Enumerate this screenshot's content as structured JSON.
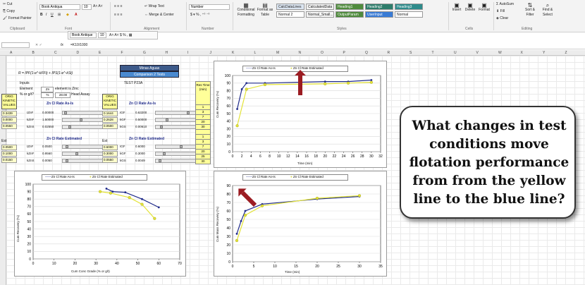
{
  "ribbon": {
    "clipboard": {
      "cut": "Cut",
      "copy": "Copy",
      "format_painter": "Format Painter",
      "group": "Clipboard"
    },
    "font": {
      "name": "Book Antiqua",
      "size": "10",
      "group": "Font"
    },
    "alignment": {
      "wrap": "Wrap Text",
      "merge": "Merge & Center",
      "group": "Alignment"
    },
    "number": {
      "format": "Number",
      "group": "Number"
    },
    "styles": {
      "conditional": "Conditional Formatting",
      "format_table": "Format as Table",
      "cells": [
        {
          "label": "Normal 2",
          "bg": "#ffffff"
        },
        {
          "label": "CalcDataLines",
          "bg": "#dbe5f1"
        },
        {
          "label": "CalculatedData",
          "bg": "#f2f2f2"
        },
        {
          "label": "Heading1",
          "bg": "#4f8b3d"
        },
        {
          "label": "Heading2",
          "bg": "#2e7d6b"
        },
        {
          "label": "Heading3",
          "bg": "#2e8b8b"
        },
        {
          "label": "Normal 2",
          "bg": "#ffffff"
        },
        {
          "label": "Normal_Small...",
          "bg": "#f7f7f7"
        },
        {
          "label": "OutputParam",
          "bg": "#4f8b3d"
        },
        {
          "label": "UserInput",
          "bg": "#3a7bd5"
        },
        {
          "label": "Normal",
          "bg": "#ffffff"
        }
      ],
      "group": "Styles"
    },
    "cells": {
      "insert": "Insert",
      "delete": "Delete",
      "format": "Format",
      "group": "Cells"
    },
    "editing": {
      "autosum": "AutoSum",
      "fill": "Fill",
      "clear": "Clear",
      "sort": "Sort & Filter",
      "find": "Find & Select",
      "group": "Editing"
    },
    "mini_font": "Book Antique",
    "mini_size": "10"
  },
  "formula_bar": {
    "name_box": "",
    "formula": "=K10/1000"
  },
  "columns": [
    "A",
    "B",
    "C",
    "D",
    "E",
    "F",
    "G",
    "H",
    "I",
    "J",
    "K",
    "L",
    "M",
    "N",
    "O",
    "P",
    "Q",
    "R",
    "S",
    "T",
    "U",
    "V",
    "W",
    "X",
    "Y",
    "Z"
  ],
  "sheet": {
    "formula": "R = IPF(1-e^-kFFt) + IPS(1-e^-kSt)",
    "inputs": "Inputs",
    "element_label": "Element",
    "element_value": "Zn",
    "element_note": "element is Zinc",
    "units_label": "% or g/t?",
    "units_value": "%",
    "head_value": "28.00",
    "head_label": "Head Assay",
    "minas": "Minas Aguas",
    "comparison": "Comparison 2 Tests",
    "test": "TEST P23A",
    "orig_box": "ORIG KINETIC VALUES",
    "asis_title": "Zn Cl Rate As-Is",
    "est_title": "Zn Cl Rate Estimated",
    "orig_left": [
      "0.3439",
      "0.0000",
      "0.0550"
    ],
    "orig_right": [
      "0.1644",
      "0.2628",
      "0.0500"
    ],
    "est_left_hdr": "Est",
    "est_right_hdr": "Est",
    "est_left": [
      "0.0500",
      "0.1000",
      "0.0150"
    ],
    "est_right": [
      "0.6000",
      "0.3000",
      "0.0550"
    ],
    "params_left": [
      {
        "name": "IZnF",
        "val": "0.00000"
      },
      {
        "name": "kZnF",
        "val": "1.50000"
      },
      {
        "name": "kZnS",
        "val": "0.02550"
      }
    ],
    "params_right": [
      {
        "name": "IGF",
        "val": "0.63200"
      },
      {
        "name": "kGF",
        "val": "0.50000"
      },
      {
        "name": "kGS",
        "val": "0.00610"
      }
    ],
    "est_params_left": [
      {
        "name": "IZnF",
        "val": "0.0500"
      },
      {
        "name": "kZnF",
        "val": "0.9560"
      },
      {
        "name": "kZnS",
        "val": "0.0050"
      }
    ],
    "est_params_right": [
      {
        "name": "IGF",
        "val": "0.6000"
      },
      {
        "name": "kGF",
        "val": "0.3000"
      },
      {
        "name": "kGS",
        "val": "0.0049"
      }
    ],
    "res_time_header": "Res Time (min)",
    "res_times": [
      "1",
      "3",
      "7",
      "20",
      "30",
      "",
      "1",
      "3",
      "7",
      "20",
      "25",
      "30"
    ]
  },
  "charts": {
    "legend_asis": "Zn Cl Rate As-Is",
    "legend_est": "Zn Cl Rate Estimated",
    "top_right": {
      "ylabel": "Cum Recovery (%)",
      "xlabel": "Time (min)",
      "yticks": [
        "100",
        "90",
        "80",
        "70",
        "60",
        "50",
        "40",
        "30",
        "20",
        "10",
        "0"
      ],
      "xticks": [
        "0",
        "2",
        "4",
        "6",
        "8",
        "10",
        "12",
        "14",
        "16",
        "18",
        "20",
        "22",
        "24",
        "26",
        "28",
        "30",
        "32"
      ]
    },
    "bottom_right": {
      "ylabel": "Cum Mass Recovery (%)",
      "xlabel": "Time (min)",
      "yticks": [
        "90",
        "80",
        "70",
        "60",
        "50",
        "40",
        "30",
        "20",
        "10",
        "0"
      ],
      "xticks": [
        "0",
        "5",
        "10",
        "15",
        "20",
        "25",
        "30",
        "35"
      ]
    },
    "left": {
      "ylabel": "Cum Recovery (%)",
      "xlabel": "Cum Conc Grade (% or g/t)",
      "yticks": [
        "100",
        "90",
        "80",
        "70",
        "60",
        "50",
        "40",
        "30",
        "20",
        "10",
        "0"
      ],
      "xticks": [
        "0",
        "10",
        "20",
        "30",
        "40",
        "50",
        "60",
        "70"
      ]
    }
  },
  "chart_data": [
    {
      "type": "line",
      "title": "",
      "xlabel": "Time (min)",
      "ylabel": "Cum Recovery (%)",
      "xlim": [
        0,
        32
      ],
      "ylim": [
        0,
        100
      ],
      "series": [
        {
          "name": "Zn Cl Rate As-Is",
          "x": [
            1,
            2,
            3,
            7,
            20,
            25,
            30
          ],
          "y": [
            56,
            82,
            90,
            90,
            92,
            92,
            94
          ]
        },
        {
          "name": "Zn Cl Rate Estimated",
          "x": [
            1,
            3,
            7,
            20,
            25,
            30
          ],
          "y": [
            34,
            82,
            88,
            89,
            90,
            91
          ]
        }
      ]
    },
    {
      "type": "line",
      "title": "",
      "xlabel": "Time (min)",
      "ylabel": "Cum Mass Recovery (%)",
      "xlim": [
        0,
        35
      ],
      "ylim": [
        0,
        90
      ],
      "series": [
        {
          "name": "Zn Cl Rate As-Is",
          "x": [
            1,
            2,
            3,
            7,
            20,
            30
          ],
          "y": [
            33,
            48,
            60,
            68,
            74,
            77
          ]
        },
        {
          "name": "Zn Cl Rate Estimated",
          "x": [
            1,
            3,
            7,
            20,
            30
          ],
          "y": [
            25,
            55,
            66,
            75,
            78
          ]
        }
      ]
    },
    {
      "type": "line",
      "title": "",
      "xlabel": "Cum Conc Grade (% or g/t)",
      "ylabel": "Cum Recovery (%)",
      "xlim": [
        0,
        70
      ],
      "ylim": [
        0,
        100
      ],
      "series": [
        {
          "name": "Zn Cl Rate As-Is",
          "x": [
            35,
            38,
            44,
            52,
            60
          ],
          "y": [
            94,
            90,
            89,
            80,
            69
          ]
        },
        {
          "name": "Zn Cl Rate Estimated",
          "x": [
            32,
            37,
            46,
            52,
            58
          ],
          "y": [
            90,
            88,
            82,
            73,
            54
          ]
        }
      ]
    }
  ],
  "callout": {
    "text": "What changes in test conditions move flotation performance from from the yellow line to the blue line?"
  },
  "colors": {
    "asis": "#1f2a8a",
    "est": "#e3e336",
    "arrow": "#9b1c22"
  }
}
